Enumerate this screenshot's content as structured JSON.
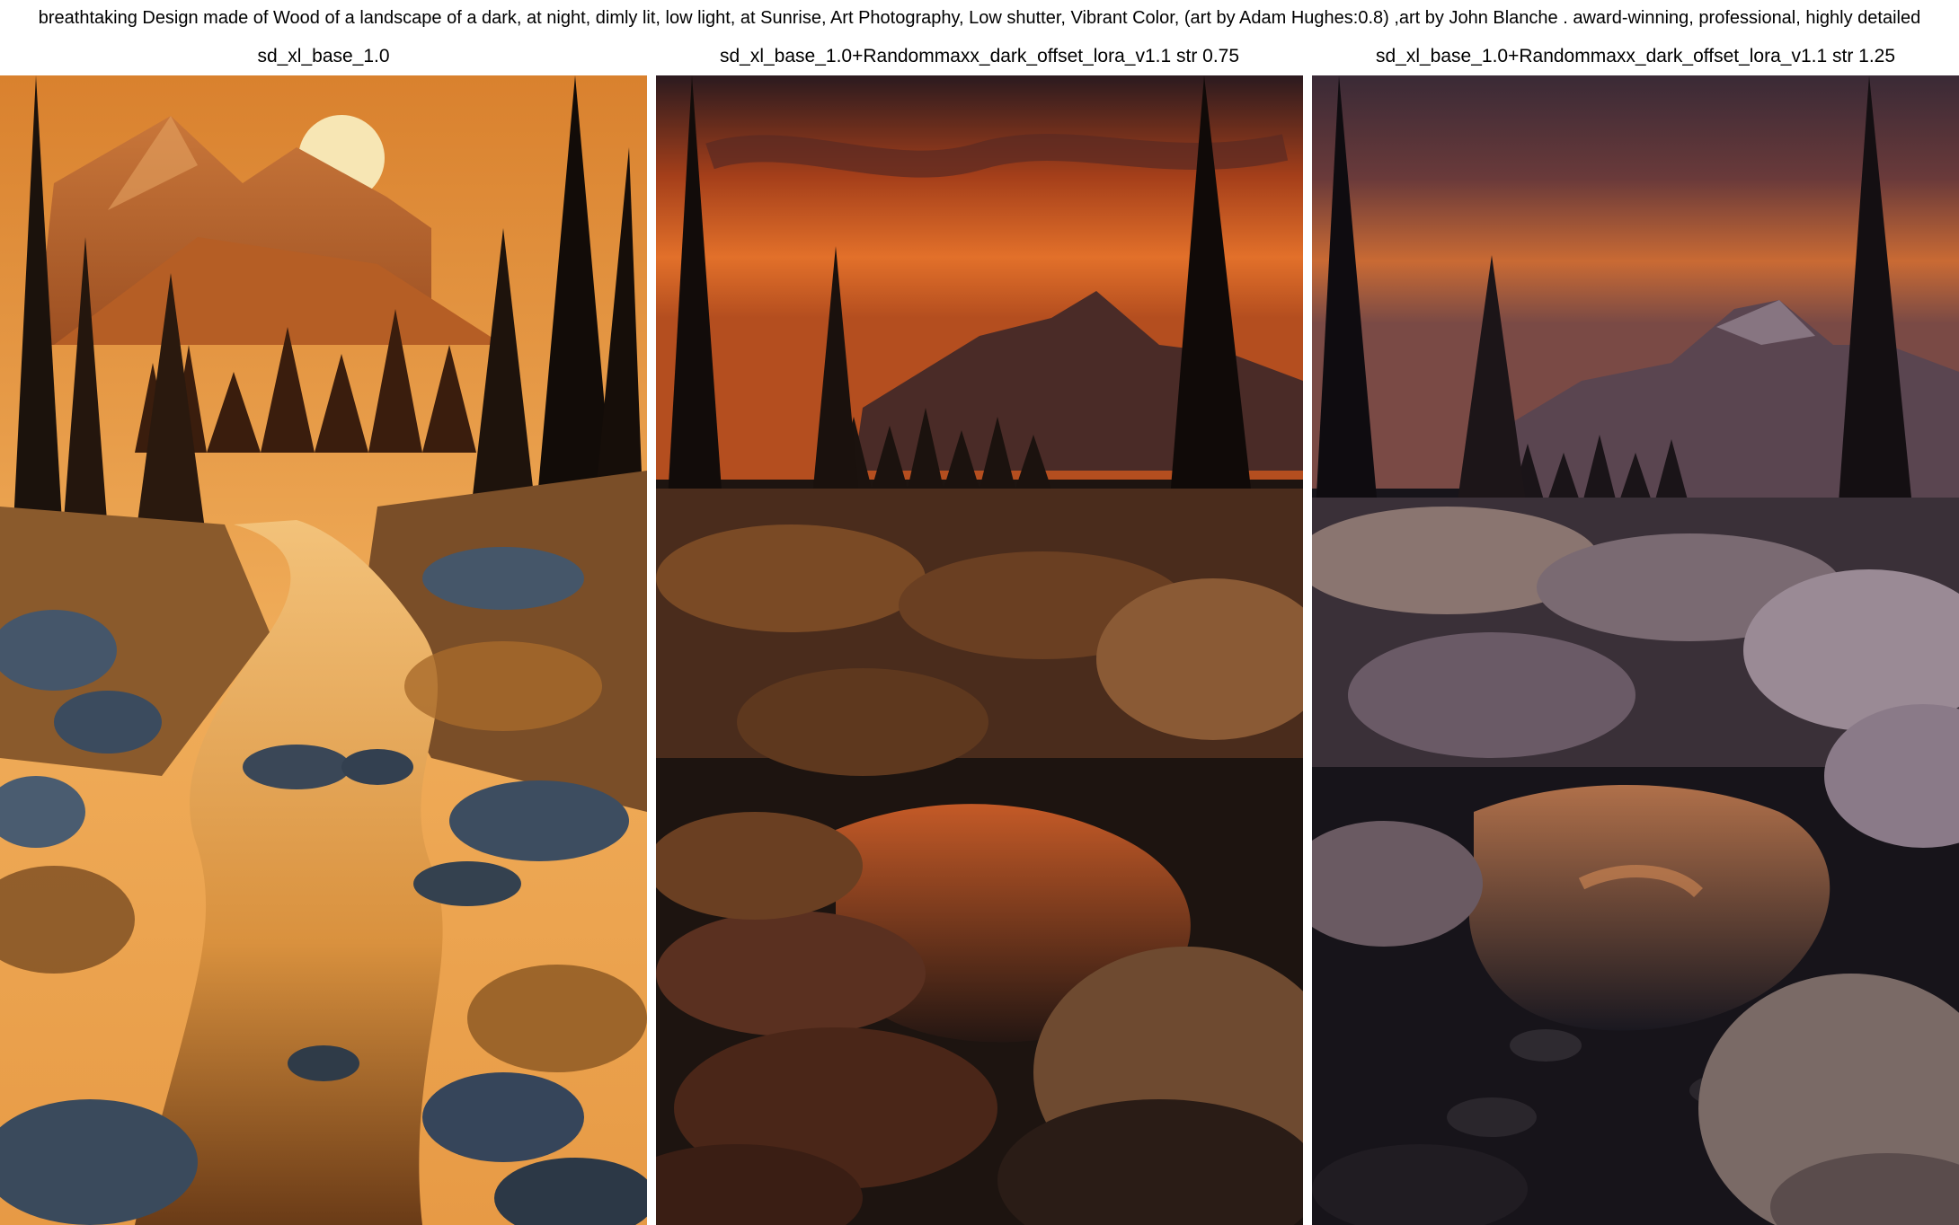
{
  "prompt": "breathtaking Design made of Wood of a landscape of a dark, at night, dimly lit, low light, at Sunrise, Art Photography, Low shutter, Vibrant Color, (art by Adam Hughes:0.8) ,art by John Blanche . award-winning, professional, highly detailed",
  "panels": [
    {
      "caption": "sd_xl_base_1.0",
      "scene": "bright-orange-river-sunrise"
    },
    {
      "caption": "sd_xl_base_1.0+Randommaxx_dark_offset_lora_v1.1 str 0.75",
      "scene": "dark-orange-creek-sunset"
    },
    {
      "caption": "sd_xl_base_1.0+Randommaxx_dark_offset_lora_v1.1 str 1.25",
      "scene": "darker-purple-creek-sunset"
    }
  ]
}
